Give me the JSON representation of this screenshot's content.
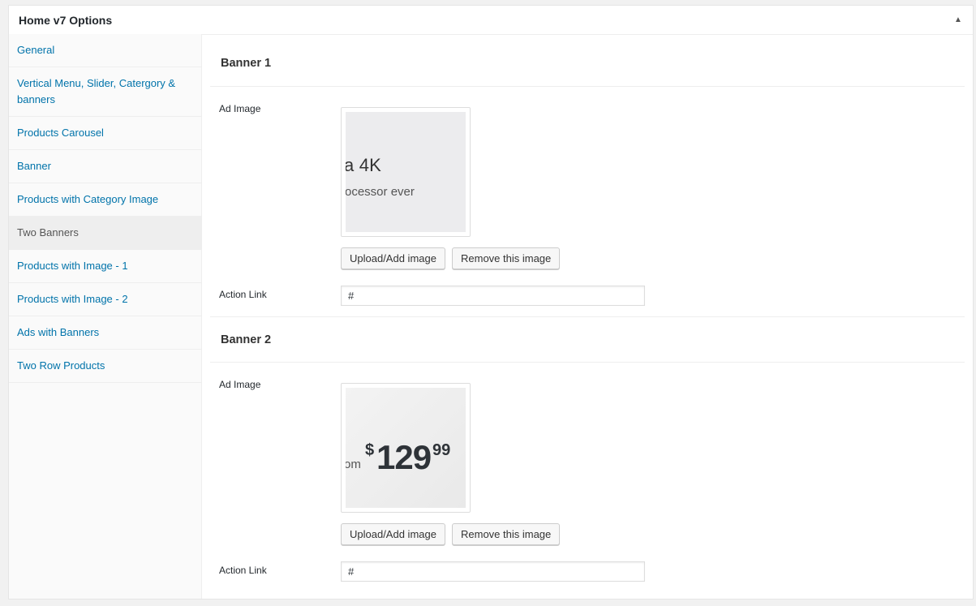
{
  "header": {
    "title": "Home v7 Options",
    "toggle_icon": "arrow-up-icon"
  },
  "sidebar": {
    "items": [
      {
        "label": "General"
      },
      {
        "label": "Vertical Menu, Slider, Catergory & banners"
      },
      {
        "label": "Products Carousel"
      },
      {
        "label": "Banner"
      },
      {
        "label": "Products with Category Image"
      },
      {
        "label": "Two Banners"
      },
      {
        "label": "Products with Image - 1"
      },
      {
        "label": "Products with Image - 2"
      },
      {
        "label": "Ads with Banners"
      },
      {
        "label": "Two Row Products"
      }
    ],
    "active": "Two Banners"
  },
  "banners": [
    {
      "title": "Banner 1",
      "ad_image_label": "Ad Image",
      "image_text_1": "a 4K",
      "image_text_2": "ocessor ever",
      "upload_label": "Upload/Add image",
      "remove_label": "Remove this image",
      "action_link_label": "Action Link",
      "action_link_value": "#"
    },
    {
      "title": "Banner 2",
      "ad_image_label": "Ad Image",
      "image_prefix": "om",
      "image_dollar": "$",
      "image_price": "129",
      "image_cents": "99",
      "upload_label": "Upload/Add image",
      "remove_label": "Remove this image",
      "action_link_label": "Action Link",
      "action_link_value": "#"
    }
  ],
  "colors": {
    "link": "#0073aa",
    "active_bg": "#eeeeee"
  }
}
